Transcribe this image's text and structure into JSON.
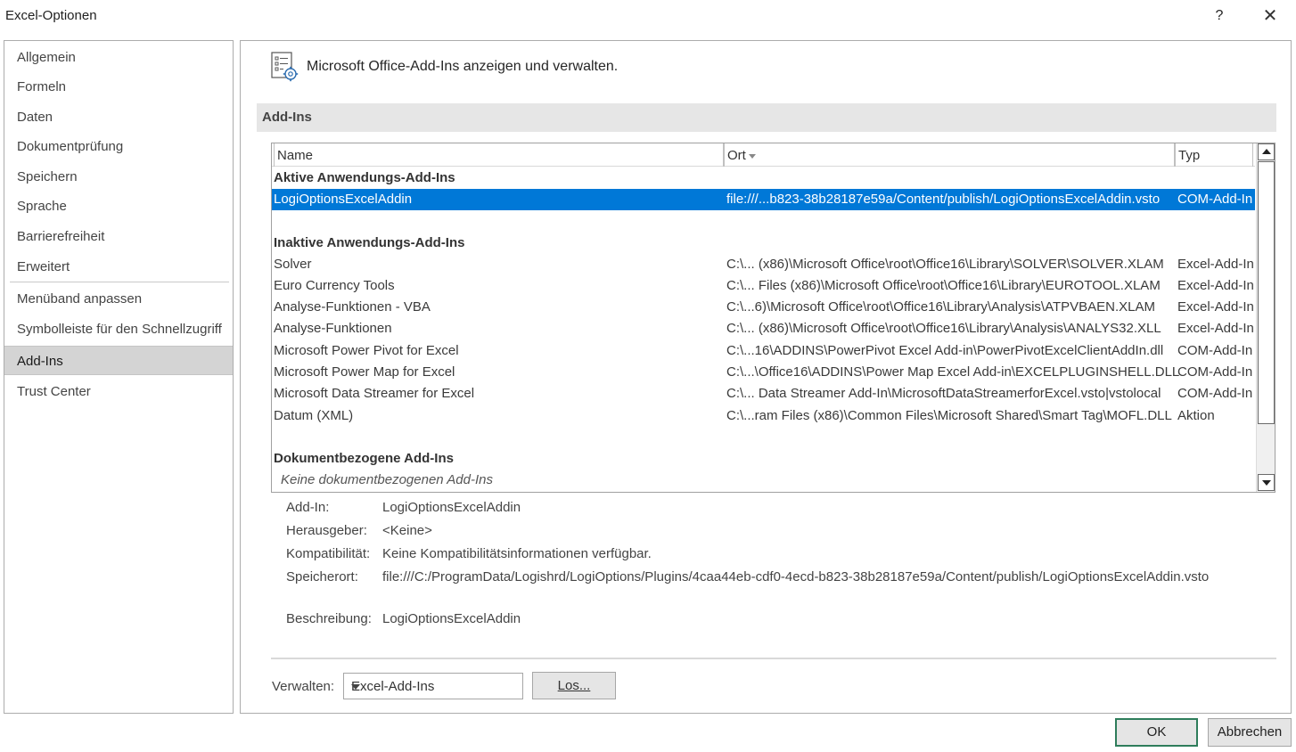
{
  "window": {
    "title": "Excel-Optionen",
    "help_label": "?",
    "close_label": "✕"
  },
  "nav": {
    "items": [
      {
        "label": "Allgemein"
      },
      {
        "label": "Formeln"
      },
      {
        "label": "Daten"
      },
      {
        "label": "Dokumentprüfung"
      },
      {
        "label": "Speichern"
      },
      {
        "label": "Sprache"
      },
      {
        "label": "Barrierefreiheit"
      },
      {
        "label": "Erweitert"
      },
      {
        "label": "Menüband anpassen"
      },
      {
        "label": "Symbolleiste für den Schnellzugriff"
      },
      {
        "label": "Add-Ins"
      },
      {
        "label": "Trust Center"
      }
    ],
    "selected": "Add-Ins"
  },
  "main": {
    "header_text": "Microsoft Office-Add-Ins anzeigen und verwalten.",
    "section_title": "Add-Ins",
    "columns": {
      "name": "Name",
      "location": "Ort",
      "type": "Typ"
    },
    "rows": [
      {
        "kind": "group",
        "name": "Aktive Anwendungs-Add-Ins",
        "location": "",
        "type": ""
      },
      {
        "kind": "item",
        "name": "LogiOptionsExcelAddin",
        "location": "file:///...b823-38b28187e59a/Content/publish/LogiOptionsExcelAddin.vsto",
        "type": "COM-Add-In",
        "selected": true
      },
      {
        "kind": "blank",
        "name": "",
        "location": "",
        "type": ""
      },
      {
        "kind": "group",
        "name": "Inaktive Anwendungs-Add-Ins",
        "location": "",
        "type": ""
      },
      {
        "kind": "item",
        "name": "Solver",
        "location": "C:\\... (x86)\\Microsoft Office\\root\\Office16\\Library\\SOLVER\\SOLVER.XLAM",
        "type": "Excel-Add-In"
      },
      {
        "kind": "item",
        "name": "Euro Currency Tools",
        "location": "C:\\... Files (x86)\\Microsoft Office\\root\\Office16\\Library\\EUROTOOL.XLAM",
        "type": "Excel-Add-In"
      },
      {
        "kind": "item",
        "name": "Analyse-Funktionen - VBA",
        "location": "C:\\...6)\\Microsoft Office\\root\\Office16\\Library\\Analysis\\ATPVBAEN.XLAM",
        "type": "Excel-Add-In"
      },
      {
        "kind": "item",
        "name": "Analyse-Funktionen",
        "location": "C:\\... (x86)\\Microsoft Office\\root\\Office16\\Library\\Analysis\\ANALYS32.XLL",
        "type": "Excel-Add-In"
      },
      {
        "kind": "item",
        "name": "Microsoft Power Pivot for Excel",
        "location": "C:\\...16\\ADDINS\\PowerPivot Excel Add-in\\PowerPivotExcelClientAddIn.dll",
        "type": "COM-Add-In"
      },
      {
        "kind": "item",
        "name": "Microsoft Power Map for Excel",
        "location": "C:\\...\\Office16\\ADDINS\\Power Map Excel Add-in\\EXCELPLUGINSHELL.DLL",
        "type": "COM-Add-In"
      },
      {
        "kind": "item",
        "name": "Microsoft Data Streamer for Excel",
        "location": "C:\\... Data Streamer Add-In\\MicrosoftDataStreamerforExcel.vsto|vstolocal",
        "type": "COM-Add-In"
      },
      {
        "kind": "item",
        "name": "Datum (XML)",
        "location": "C:\\...ram Files (x86)\\Common Files\\Microsoft Shared\\Smart Tag\\MOFL.DLL",
        "type": "Aktion"
      },
      {
        "kind": "blank",
        "name": "",
        "location": "",
        "type": ""
      },
      {
        "kind": "group",
        "name": "Dokumentbezogene Add-Ins",
        "location": "",
        "type": ""
      },
      {
        "kind": "note",
        "name": "Keine dokumentbezogenen Add-Ins",
        "location": "",
        "type": ""
      }
    ],
    "details": {
      "addin_label": "Add-In:",
      "addin_value": "LogiOptionsExcelAddin",
      "publisher_label": "Herausgeber:",
      "publisher_value": "<Keine>",
      "compat_label": "Kompatibilität:",
      "compat_value": "Keine Kompatibilitätsinformationen verfügbar.",
      "location_label": "Speicherort:",
      "location_value": "file:///C:/ProgramData/Logishrd/LogiOptions/Plugins/4caa44eb-cdf0-4ecd-b823-38b28187e59a/Content/publish/LogiOptionsExcelAddin.vsto",
      "description_label": "Beschreibung:",
      "description_value": "LogiOptionsExcelAddin"
    },
    "manage": {
      "label": "Verwalten:",
      "selected": "Excel-Add-Ins",
      "go_label": "Los..."
    }
  },
  "footer": {
    "ok_label": "OK",
    "cancel_label": "Abbrechen"
  },
  "colors": {
    "selection": "#0078d7",
    "nav_selected": "#d4d4d4",
    "ok_border": "#2e7d5b",
    "section_band": "#e6e6e6"
  }
}
